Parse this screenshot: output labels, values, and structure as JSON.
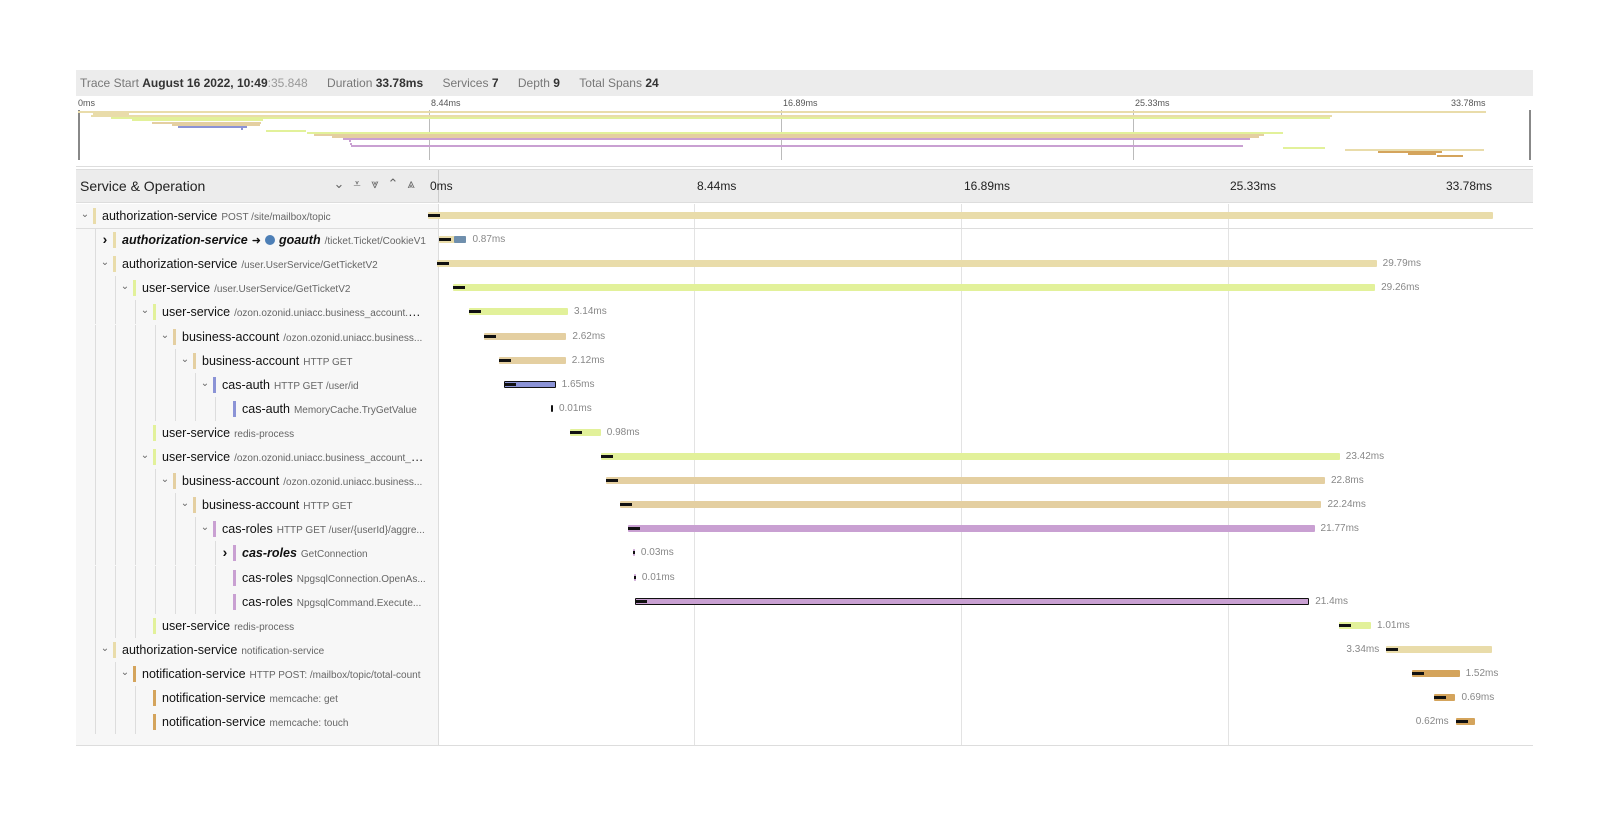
{
  "summary": {
    "trace_start_label": "Trace Start",
    "trace_start_date": "August 16 2022, 10:49",
    "trace_start_seconds": ":35.848",
    "duration_label": "Duration",
    "duration_value": "33.78ms",
    "services_label": "Services",
    "services_value": "7",
    "depth_label": "Depth",
    "depth_value": "9",
    "total_spans_label": "Total Spans",
    "total_spans_value": "24"
  },
  "minimap": {
    "ticks": [
      "0ms",
      "8.44ms",
      "16.89ms",
      "25.33ms",
      "33.78ms"
    ]
  },
  "header": {
    "title": "Service & Operation",
    "controls": [
      "⌄",
      "⩡",
      "⩔",
      "⌃",
      "⩓"
    ],
    "ticks": [
      "0ms",
      "8.44ms",
      "16.89ms",
      "25.33ms",
      "33.78ms"
    ]
  },
  "colors": {
    "authorization-service": "#e9dcaa",
    "user-service": "#e2f19a",
    "business-account": "#e4cfa1",
    "cas-auth": "#8b93d6",
    "cas-roles": "#c9a0d2",
    "notification-service": "#d4a45c",
    "goauth": "#6f8fad"
  },
  "spans": [
    {
      "service": "authorization-service",
      "operation": "POST /site/mailbox/topic",
      "depth": 0,
      "toggle": "expanded",
      "duration": "",
      "start_ms": 0,
      "dur_ms": 33.78
    },
    {
      "service": "authorization-service",
      "operation": "/ticket.Ticket/CookieV1",
      "depth": 1,
      "toggle": "collapsed",
      "peer": "goauth",
      "bold": true,
      "duration": "0.87ms",
      "start_ms": 0.35,
      "dur_ms": 0.87
    },
    {
      "service": "authorization-service",
      "operation": "/user.UserService/GetTicketV2",
      "depth": 1,
      "toggle": "expanded",
      "duration": "29.79ms",
      "start_ms": 0.3,
      "dur_ms": 29.79
    },
    {
      "service": "user-service",
      "operation": "/user.UserService/GetTicketV2",
      "depth": 2,
      "toggle": "expanded",
      "duration": "29.26ms",
      "start_ms": 0.78,
      "dur_ms": 29.26
    },
    {
      "service": "user-service",
      "operation": "/ozon.ozonid.uniacc.business_account.Bu...",
      "depth": 3,
      "toggle": "expanded",
      "duration": "3.14ms",
      "start_ms": 1.3,
      "dur_ms": 3.14
    },
    {
      "service": "business-account",
      "operation": "/ozon.ozonid.uniacc.business...",
      "depth": 4,
      "toggle": "expanded",
      "duration": "2.62ms",
      "start_ms": 1.77,
      "dur_ms": 2.62
    },
    {
      "service": "business-account",
      "operation": "HTTP GET",
      "depth": 5,
      "toggle": "expanded",
      "duration": "2.12ms",
      "start_ms": 2.25,
      "dur_ms": 2.12
    },
    {
      "service": "cas-auth",
      "operation": "HTTP GET /user/id",
      "depth": 6,
      "toggle": "expanded",
      "duration": "1.65ms",
      "start_ms": 2.4,
      "dur_ms": 1.65
    },
    {
      "service": "cas-auth",
      "operation": "MemoryCache.TryGetValue",
      "depth": 7,
      "toggle": "none",
      "duration": "0.01ms",
      "start_ms": 3.9,
      "dur_ms": 0.01
    },
    {
      "service": "user-service",
      "operation": "redis-process",
      "depth": 3,
      "toggle": "none",
      "duration": "0.98ms",
      "start_ms": 4.5,
      "dur_ms": 0.98
    },
    {
      "service": "user-service",
      "operation": "/ozon.ozonid.uniacc.business_account_rol...",
      "depth": 3,
      "toggle": "expanded",
      "duration": "23.42ms",
      "start_ms": 5.5,
      "dur_ms": 23.42
    },
    {
      "service": "business-account",
      "operation": "/ozon.ozonid.uniacc.business...",
      "depth": 4,
      "toggle": "expanded",
      "duration": "22.8ms",
      "start_ms": 5.65,
      "dur_ms": 22.8
    },
    {
      "service": "business-account",
      "operation": "HTTP GET",
      "depth": 5,
      "toggle": "expanded",
      "duration": "22.24ms",
      "start_ms": 6.1,
      "dur_ms": 22.24
    },
    {
      "service": "cas-roles",
      "operation": "HTTP GET /user/{userId}/aggre...",
      "depth": 6,
      "toggle": "expanded",
      "duration": "21.77ms",
      "start_ms": 6.35,
      "dur_ms": 21.77
    },
    {
      "service": "cas-roles",
      "operation": "GetConnection",
      "depth": 7,
      "toggle": "collapsed",
      "bold": true,
      "duration": "0.03ms",
      "start_ms": 6.5,
      "dur_ms": 0.03
    },
    {
      "service": "cas-roles",
      "operation": "NpgsqlConnection.OpenAs...",
      "depth": 7,
      "toggle": "none",
      "duration": "0.01ms",
      "start_ms": 6.53,
      "dur_ms": 0.01
    },
    {
      "service": "cas-roles",
      "operation": "NpgsqlCommand.Execute...",
      "depth": 7,
      "toggle": "none",
      "duration": "21.4ms",
      "start_ms": 6.55,
      "dur_ms": 21.4
    },
    {
      "service": "user-service",
      "operation": "redis-process",
      "depth": 3,
      "toggle": "none",
      "duration": "1.01ms",
      "start_ms": 28.9,
      "dur_ms": 1.01
    },
    {
      "service": "authorization-service",
      "operation": "notification-service",
      "depth": 1,
      "toggle": "expanded",
      "duration": "3.34ms",
      "start_ms": 30.4,
      "dur_ms": 3.34
    },
    {
      "service": "notification-service",
      "operation": "HTTP POST: /mailbox/topic/total-count",
      "depth": 2,
      "toggle": "expanded",
      "duration": "1.52ms",
      "start_ms": 31.2,
      "dur_ms": 1.52
    },
    {
      "service": "notification-service",
      "operation": "memcache: get",
      "depth": 3,
      "toggle": "none",
      "duration": "0.69ms",
      "start_ms": 31.9,
      "dur_ms": 0.69
    },
    {
      "service": "notification-service",
      "operation": "memcache: touch",
      "depth": 3,
      "toggle": "none",
      "duration": "0.62ms",
      "start_ms": 32.6,
      "dur_ms": 0.62
    }
  ]
}
